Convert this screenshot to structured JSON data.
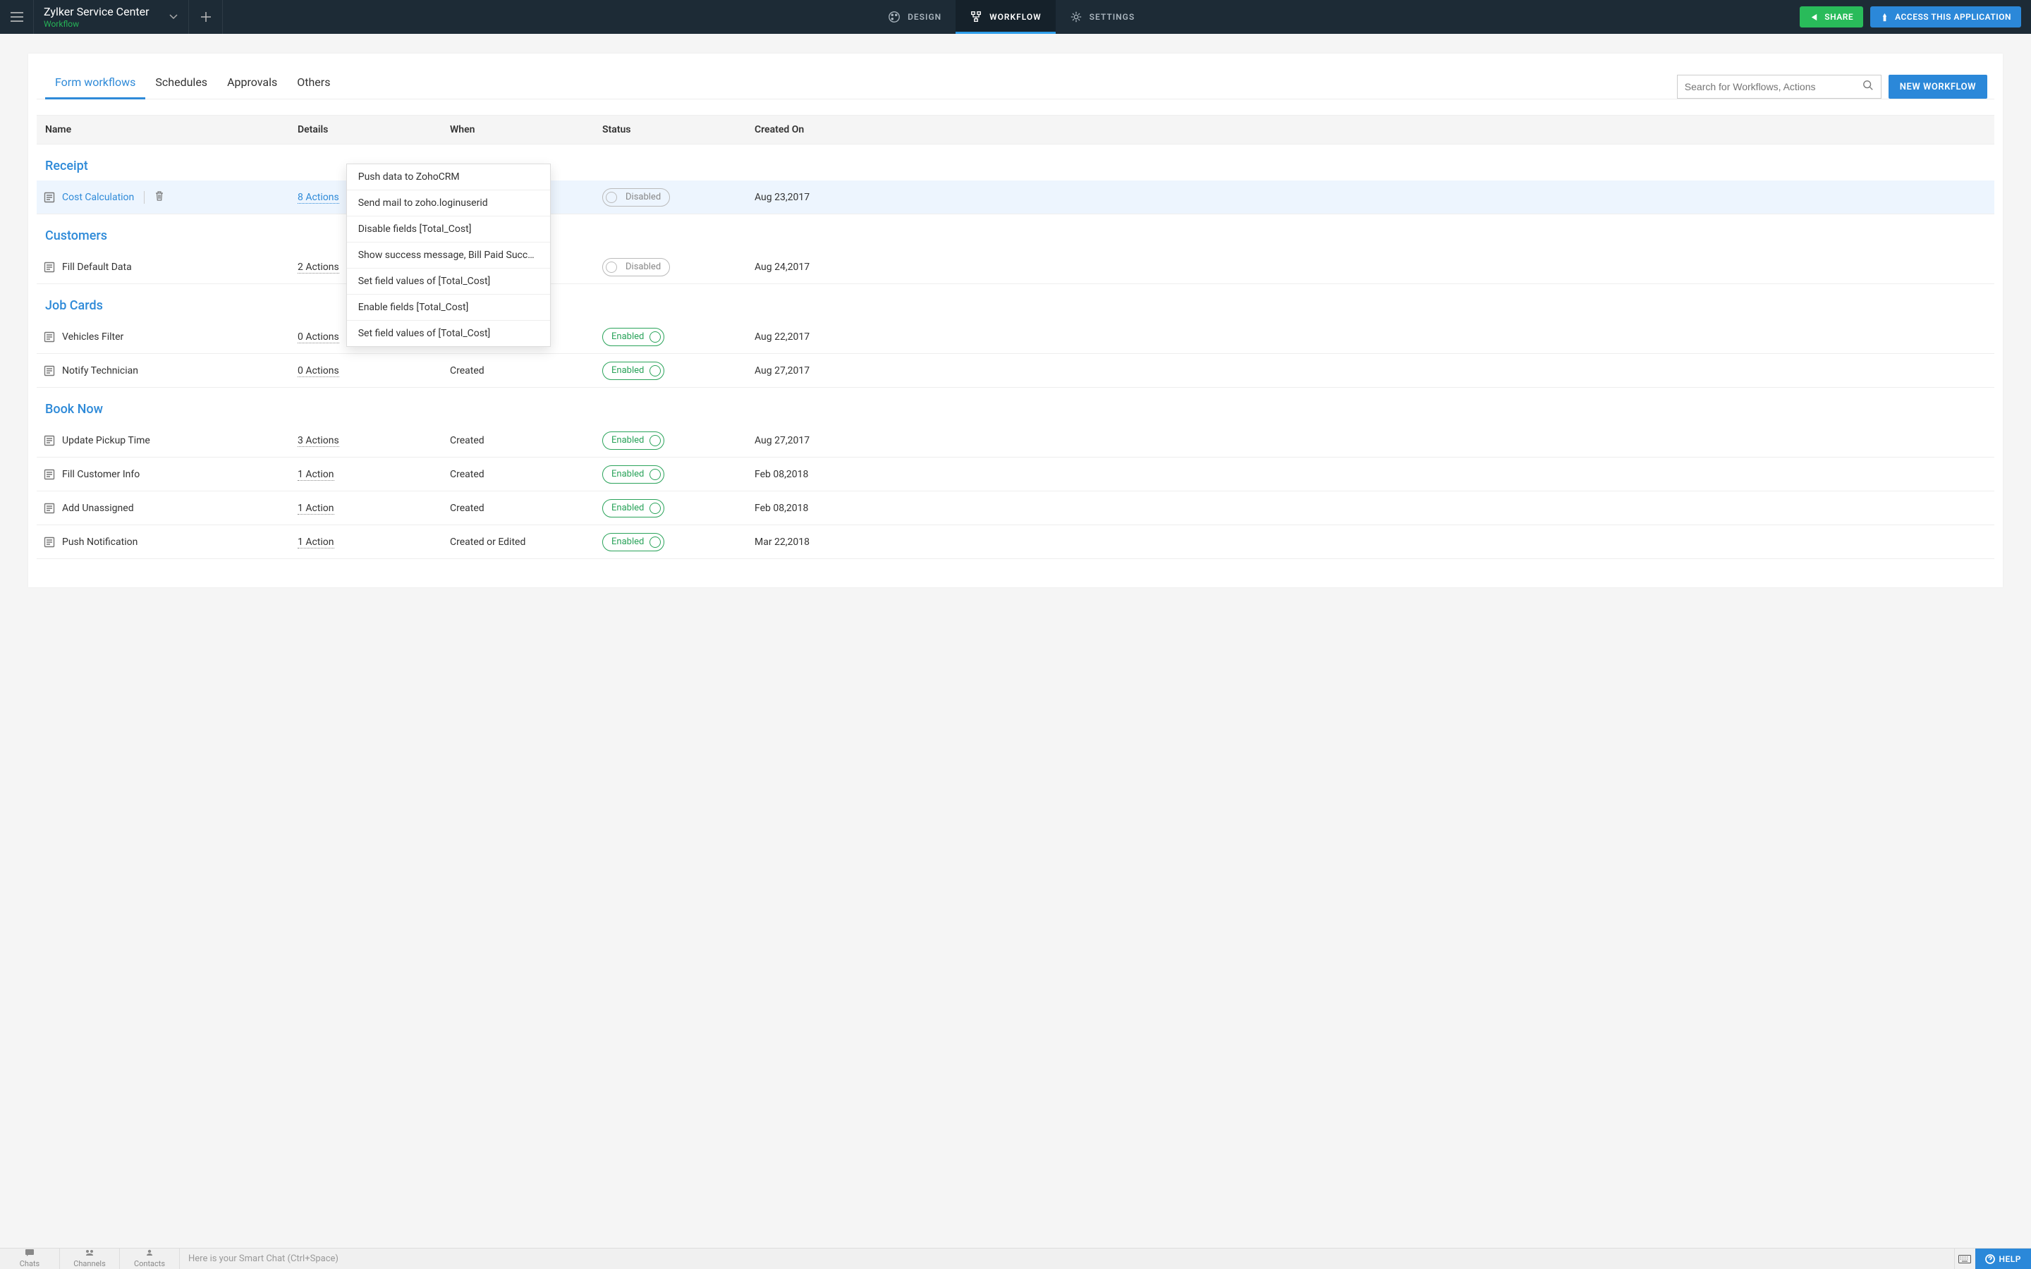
{
  "header": {
    "app_title": "Zylker Service Center",
    "app_subtitle": "Workflow",
    "tabs": {
      "design": "DESIGN",
      "workflow": "WORKFLOW",
      "settings": "SETTINGS"
    },
    "share": "SHARE",
    "access": "ACCESS  THIS  APPLICATION"
  },
  "panel_tabs": {
    "form_workflows": "Form workflows",
    "schedules": "Schedules",
    "approvals": "Approvals",
    "others": "Others"
  },
  "search_placeholder": "Search for Workflows, Actions",
  "new_workflow": "NEW WORKFLOW",
  "columns": {
    "name": "Name",
    "details": "Details",
    "when": "When",
    "status": "Status",
    "created": "Created On"
  },
  "status_labels": {
    "enabled": "Enabled",
    "disabled": "Disabled"
  },
  "sections": [
    {
      "title": "Receipt",
      "rows": [
        {
          "name": "Cost Calculation",
          "details": "8 Actions",
          "when": "",
          "status": "disabled",
          "created": "Aug 23,2017",
          "highlight": true,
          "linky": true,
          "details_selected": true,
          "show_trash": true
        }
      ]
    },
    {
      "title": "Customers",
      "rows": [
        {
          "name": "Fill Default Data",
          "details": "2 Actions",
          "when": "",
          "status": "disabled",
          "created": "Aug 24,2017"
        }
      ]
    },
    {
      "title": "Job Cards",
      "rows": [
        {
          "name": "Vehicles Filter",
          "details": "0 Actions",
          "when": "Created",
          "status": "enabled",
          "created": "Aug 22,2017"
        },
        {
          "name": "Notify Technician",
          "details": "0 Actions",
          "when": "Created",
          "status": "enabled",
          "created": "Aug 27,2017"
        }
      ]
    },
    {
      "title": "Book Now",
      "rows": [
        {
          "name": "Update Pickup Time",
          "details": "3 Actions",
          "when": "Created",
          "status": "enabled",
          "created": "Aug 27,2017"
        },
        {
          "name": "Fill Customer Info",
          "details": "1 Action",
          "when": "Created",
          "status": "enabled",
          "created": "Feb 08,2018"
        },
        {
          "name": "Add Unassigned",
          "details": "1 Action",
          "when": "Created",
          "status": "enabled",
          "created": "Feb 08,2018"
        },
        {
          "name": "Push Notification",
          "details": "1 Action",
          "when": "Created or Edited",
          "status": "enabled",
          "created": "Mar 22,2018"
        }
      ]
    }
  ],
  "popup_items": [
    "Push data to ZohoCRM",
    "Send mail to zoho.loginuserid",
    "Disable fields [Total_Cost]",
    "Show success message, Bill Paid Succes...",
    "Set field values of [Total_Cost]",
    "Enable fields [Total_Cost]",
    "Set field values of [Total_Cost]"
  ],
  "bottom": {
    "chats": "Chats",
    "channels": "Channels",
    "contacts": "Contacts",
    "hint": "Here is your Smart Chat (Ctrl+Space)",
    "help": "HELP"
  }
}
